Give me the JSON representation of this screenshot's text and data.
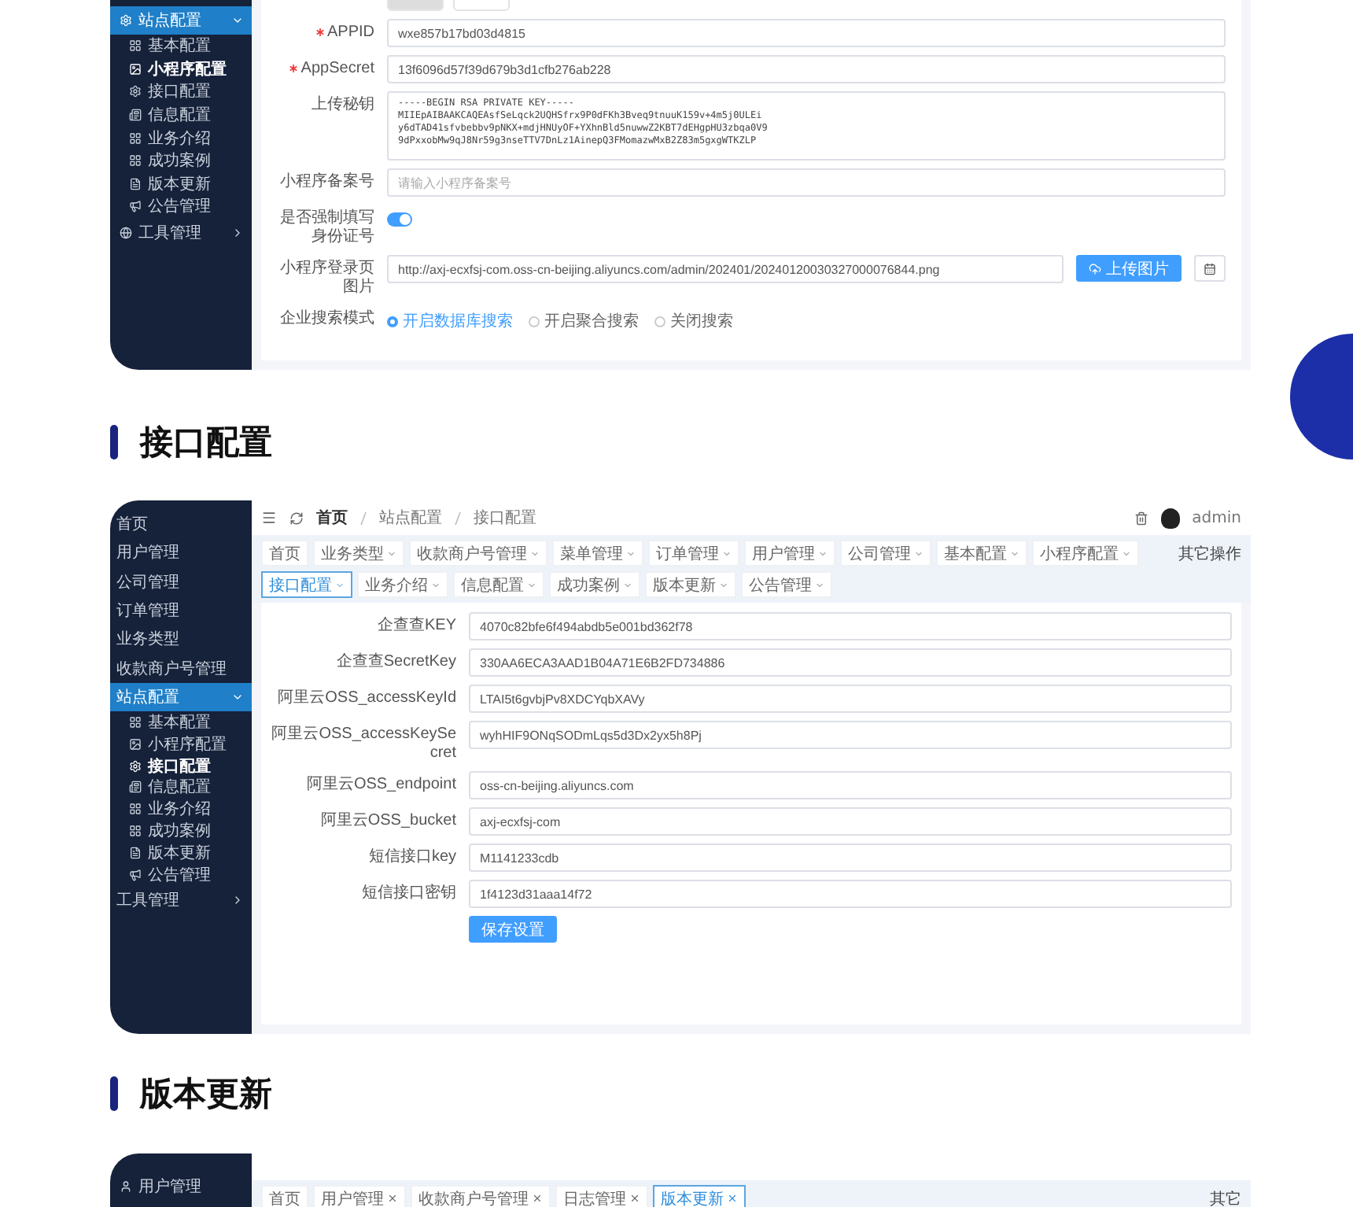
{
  "panel_top": {
    "sidebar": {
      "items": [
        {
          "label": "站点配置",
          "selected": true,
          "expanded": true,
          "children": [
            {
              "label": "基本配置",
              "selected": false
            },
            {
              "label": "小程序配置",
              "selected": true
            },
            {
              "label": "接口配置",
              "selected": false
            },
            {
              "label": "信息配置",
              "selected": false
            },
            {
              "label": "业务介绍",
              "selected": false
            },
            {
              "label": "成功案例",
              "selected": false
            },
            {
              "label": "版本更新",
              "selected": false
            },
            {
              "label": "公告管理",
              "selected": false
            }
          ]
        },
        {
          "label": "工具管理",
          "selected": false,
          "expanded": false
        }
      ]
    },
    "fields": [
      {
        "kind": "input",
        "label": "APPID",
        "required": true,
        "value": "wxe857b17bd03d4815"
      },
      {
        "kind": "input",
        "label": "AppSecret",
        "required": true,
        "value": "13f6096d57f39d679b3d1cfb276ab228"
      },
      {
        "kind": "textarea",
        "label": "上传秘钥",
        "required": false,
        "lines": [
          "-----BEGIN RSA PRIVATE KEY-----",
          "MIIEpAIBAAKCAQEAsfSeLqck2UQHSfrx9P0dFKh3Bveq9tnuuK159v+4m5j0ULEi",
          "y6dTAD41sfvbebbv9pNKX+mdjHNUyOF+YXhnBld5nuwwZ2KBT7dEHgpHU3zbqa0V9",
          "9dPxxobMw9qJ8Nr59g3nseTTV7DnLz1AinepQ3FMomazwMxB2Z83m5gxgWTKZLP"
        ]
      },
      {
        "kind": "input",
        "label": "小程序备案号",
        "required": false,
        "placeholder": "请输入小程序备案号"
      },
      {
        "kind": "switch",
        "label": "是否强制填写身份证号",
        "required": false,
        "on": true
      },
      {
        "kind": "upload",
        "label": "小程序登录页图片",
        "required": false,
        "value": "http://axj-ecxfsj-com.oss-cn-beijing.aliyuncs.com/admin/202401/20240120030327000076844.png",
        "button": "上传图片"
      },
      {
        "kind": "radio",
        "label": "企业搜索模式",
        "required": false,
        "options": [
          {
            "label": "开启数据库搜索",
            "selected": true
          },
          {
            "label": "开启聚合搜索",
            "selected": false
          },
          {
            "label": "关闭搜索",
            "selected": false
          }
        ]
      }
    ]
  },
  "heading_1": "接口配置",
  "panel_interface": {
    "breadcrumb": [
      "首页",
      "站点配置",
      "接口配置"
    ],
    "user": "admin",
    "sidebar": {
      "items": [
        {
          "label": "首页",
          "selected": false
        },
        {
          "label": "用户管理",
          "selected": false
        },
        {
          "label": "公司管理",
          "selected": false
        },
        {
          "label": "订单管理",
          "selected": false
        },
        {
          "label": "业务类型",
          "selected": false
        },
        {
          "label": "收款商户号管理",
          "selected": false
        },
        {
          "label": "站点配置",
          "selected": true,
          "expanded": true,
          "children": [
            {
              "label": "基本配置",
              "selected": false
            },
            {
              "label": "小程序配置",
              "selected": false
            },
            {
              "label": "接口配置",
              "selected": true
            },
            {
              "label": "信息配置",
              "selected": false
            },
            {
              "label": "业务介绍",
              "selected": false
            },
            {
              "label": "成功案例",
              "selected": false
            },
            {
              "label": "版本更新",
              "selected": false
            },
            {
              "label": "公告管理",
              "selected": false
            }
          ]
        },
        {
          "label": "工具管理",
          "selected": false,
          "expanded": false
        }
      ]
    },
    "tabs": [
      {
        "label": "首页",
        "kind": "plain",
        "selected": false
      },
      {
        "label": "业务类型",
        "kind": "menu",
        "selected": false
      },
      {
        "label": "收款商户号管理",
        "kind": "menu",
        "selected": false
      },
      {
        "label": "菜单管理",
        "kind": "menu",
        "selected": false
      },
      {
        "label": "订单管理",
        "kind": "menu",
        "selected": false
      },
      {
        "label": "用户管理",
        "kind": "menu",
        "selected": false
      },
      {
        "label": "公司管理",
        "kind": "menu",
        "selected": false
      },
      {
        "label": "基本配置",
        "kind": "menu",
        "selected": false
      },
      {
        "label": "小程序配置",
        "kind": "menu",
        "selected": false
      },
      {
        "label": "接口配置",
        "kind": "menu",
        "selected": true
      },
      {
        "label": "业务介绍",
        "kind": "menu",
        "selected": false
      },
      {
        "label": "信息配置",
        "kind": "menu",
        "selected": false
      },
      {
        "label": "成功案例",
        "kind": "menu",
        "selected": false
      },
      {
        "label": "版本更新",
        "kind": "menu",
        "selected": false
      },
      {
        "label": "公告管理",
        "kind": "menu",
        "selected": false
      }
    ],
    "other_actions": "其它操作",
    "fields": [
      {
        "label": "企查查KEY",
        "value": "4070c82bfe6f494abdb5e001bd362f78"
      },
      {
        "label": "企查查SecretKey",
        "value": "330AA6ECA3AAD1B04A71E6B2FD734886"
      },
      {
        "label": "阿里云OSS_accessKeyId",
        "value": "LTAI5t6gvbjPv8XDCYqbXAVy"
      },
      {
        "label": "阿里云OSS_accessKeySecret",
        "value": "wyhHIF9ONqSODmLqs5d3Dx2yx5h8Pj"
      },
      {
        "label": "阿里云OSS_endpoint",
        "value": "oss-cn-beijing.aliyuncs.com"
      },
      {
        "label": "阿里云OSS_bucket",
        "value": "axj-ecxfsj-com"
      },
      {
        "label": "短信接口key",
        "value": "M1141233cdb"
      },
      {
        "label": "短信接口密钥",
        "value": "1f4123d31aaa14f72"
      }
    ],
    "save_button": "保存设置"
  },
  "heading_2": "版本更新",
  "panel_version": {
    "sidebar": {
      "items": [
        {
          "label": "用户管理",
          "selected": false
        }
      ]
    },
    "tabs": [
      {
        "label": "首页",
        "kind": "plain",
        "selected": false
      },
      {
        "label": "用户管理",
        "kind": "closable",
        "selected": false
      },
      {
        "label": "收款商户号管理",
        "kind": "closable",
        "selected": false
      },
      {
        "label": "日志管理",
        "kind": "closable",
        "selected": false
      },
      {
        "label": "版本更新",
        "kind": "closable",
        "selected": true
      }
    ],
    "other_actions": "其它"
  }
}
